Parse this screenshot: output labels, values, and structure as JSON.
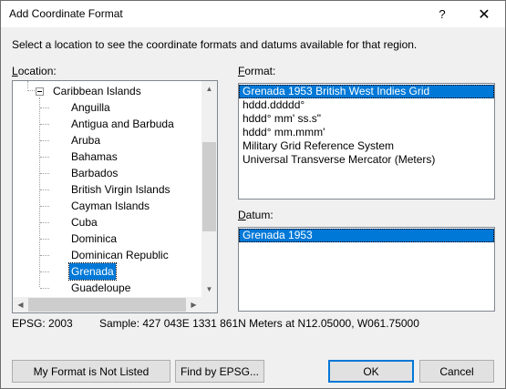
{
  "window": {
    "title": "Add Coordinate Format",
    "help_glyph": "?",
    "close_glyph": "✕"
  },
  "instruction": "Select a location to see the coordinate formats and datums available for that region.",
  "location": {
    "label_accel": "L",
    "label_rest": "ocation:",
    "parent": "Caribbean Islands",
    "items": [
      "Anguilla",
      "Antigua and Barbuda",
      "Aruba",
      "Bahamas",
      "Barbados",
      "British Virgin Islands",
      "Cayman Islands",
      "Cuba",
      "Dominica",
      "Dominican Republic",
      "Grenada",
      "Guadeloupe"
    ],
    "selected": "Grenada"
  },
  "format": {
    "label_accel": "F",
    "label_rest": "ormat:",
    "items": [
      "Grenada 1953 British West Indies Grid",
      "hddd.ddddd°",
      "hddd° mm' ss.s\"",
      "hddd° mm.mmm'",
      "Military Grid Reference System",
      "Universal Transverse Mercator (Meters)"
    ],
    "selected": "Grenada 1953 British West Indies Grid"
  },
  "datum": {
    "label_accel": "D",
    "label_rest": "atum:",
    "items": [
      "Grenada 1953"
    ],
    "selected": "Grenada 1953"
  },
  "status": {
    "epsg": "EPSG: 2003",
    "sample": "Sample: 427 043E  1331 861N Meters at N12.05000, W061.75000"
  },
  "buttons": {
    "not_listed": "My Format is Not Listed",
    "find_epsg": "Find by EPSG...",
    "ok": "OK",
    "cancel": "Cancel"
  },
  "colors": {
    "selection": "#0078d7",
    "face": "#f0f0f0",
    "button": "#e1e1e1"
  }
}
